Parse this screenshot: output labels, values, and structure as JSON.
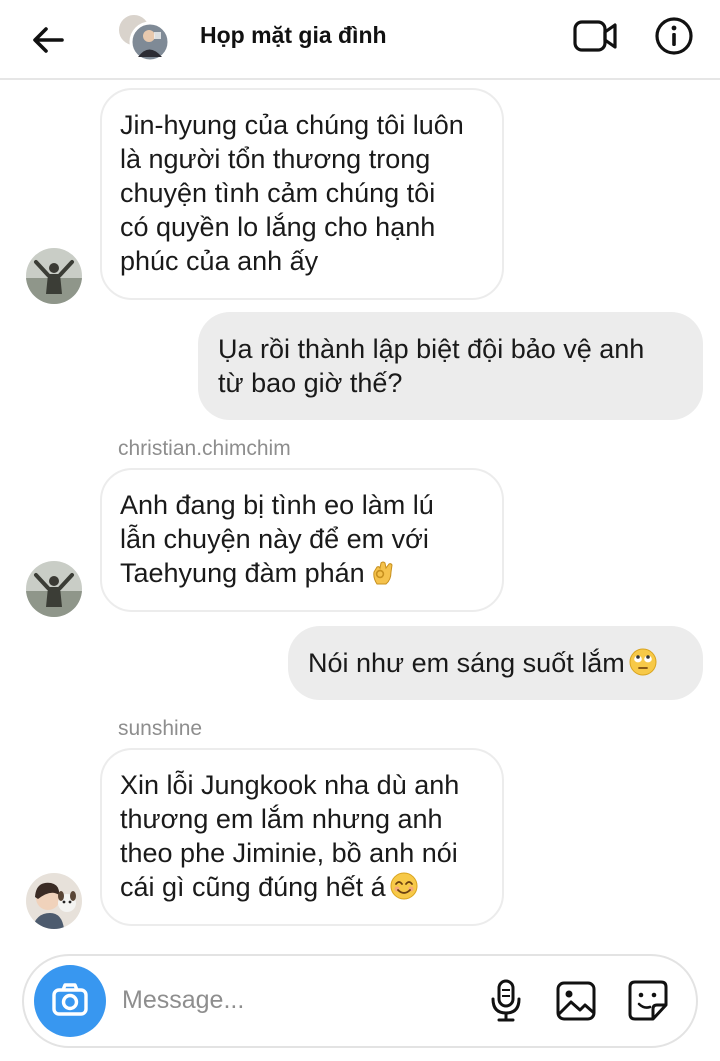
{
  "header": {
    "title": "Họp mặt gia đình"
  },
  "messages": [
    {
      "direction": "incoming",
      "sender": "",
      "lines": [
        "Jin-hyung của chúng tôi luôn",
        "là người tổn thương trong",
        "chuyện tình cảm chúng tôi",
        "có quyền lo lắng cho hạnh",
        "phúc của anh ấy"
      ]
    },
    {
      "direction": "outgoing",
      "lines": [
        "Ụa rồi thành lập biệt đội bảo vệ anh",
        "từ bao giờ thế?"
      ]
    },
    {
      "direction": "incoming",
      "sender": "christian.chimchim",
      "lines": [
        "Anh đang bị tình eo làm lú",
        "lẫn chuyện này để em với",
        "Taehyung đàm phán"
      ],
      "emoji": "ok-hand-emoji"
    },
    {
      "direction": "outgoing",
      "lines": [
        "Nói như em sáng suốt lắm"
      ],
      "emoji": "eye-roll-emoji"
    },
    {
      "direction": "incoming",
      "sender": "sunshine",
      "lines": [
        "Xin lỗi Jungkook nha dù anh",
        "thương em lắm nhưng anh",
        "theo phe Jiminie, bồ anh nói",
        "cái gì cũng đúng hết á"
      ],
      "emoji": "smiling-emoji"
    }
  ],
  "composer": {
    "placeholder": "Message..."
  },
  "icons": {
    "back": "back-arrow-icon",
    "video": "video-call-icon",
    "info": "info-icon",
    "camera": "camera-icon",
    "mic": "microphone-icon",
    "gallery": "gallery-icon",
    "sticker": "sticker-icon"
  },
  "colors": {
    "accent": "#3897f0",
    "outgoing_bubble": "#ececec",
    "incoming_border": "#ececec",
    "sender_label": "#8e8e8e"
  }
}
